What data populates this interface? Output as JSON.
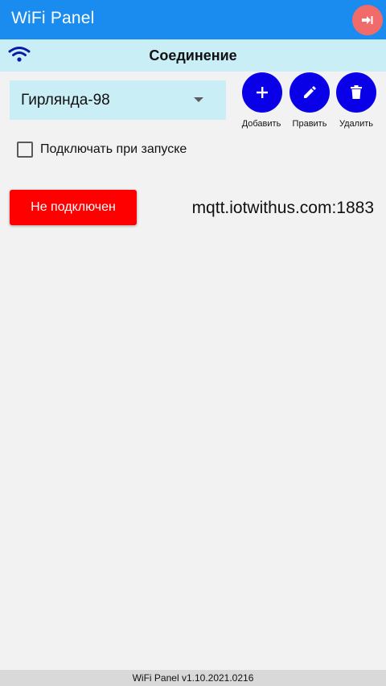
{
  "app": {
    "title": "WiFi Panel",
    "exit_icon": "exit-icon",
    "accent_color": "#1a8cf0",
    "exit_color": "#f26b6b"
  },
  "connection_bar": {
    "title": "Соединение",
    "icon": "wifi-icon",
    "background": "#c9eef5"
  },
  "profile": {
    "selected": "Гирлянда-98"
  },
  "actions": [
    {
      "icon": "plus-icon",
      "label": "Добавить"
    },
    {
      "icon": "pencil-icon",
      "label": "Править"
    },
    {
      "icon": "trash-icon",
      "label": "Удалить"
    }
  ],
  "autoconnect": {
    "label": "Подключать при запуске",
    "checked": false
  },
  "status": {
    "label": "Не подключен",
    "color": "#ff0000"
  },
  "server": {
    "address": "mqtt.iotwithus.com:1883"
  },
  "footer": {
    "version": "WiFi Panel v1.10.2021.0216"
  }
}
